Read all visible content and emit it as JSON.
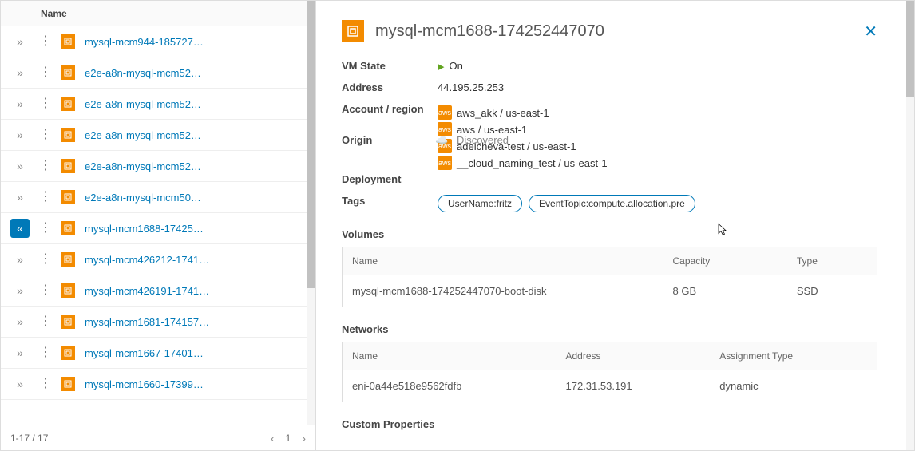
{
  "list": {
    "header": "Name",
    "rows": [
      {
        "name": "mysql-mcm944-185727…",
        "expanded": false
      },
      {
        "name": "e2e-a8n-mysql-mcm52…",
        "expanded": false
      },
      {
        "name": "e2e-a8n-mysql-mcm52…",
        "expanded": false
      },
      {
        "name": "e2e-a8n-mysql-mcm52…",
        "expanded": false
      },
      {
        "name": "e2e-a8n-mysql-mcm52…",
        "expanded": false
      },
      {
        "name": "e2e-a8n-mysql-mcm50…",
        "expanded": false
      },
      {
        "name": "mysql-mcm1688-17425…",
        "expanded": true
      },
      {
        "name": "mysql-mcm426212-1741…",
        "expanded": false
      },
      {
        "name": "mysql-mcm426191-1741…",
        "expanded": false
      },
      {
        "name": "mysql-mcm1681-174157…",
        "expanded": false
      },
      {
        "name": "mysql-mcm1667-17401…",
        "expanded": false
      },
      {
        "name": "mysql-mcm1660-17399…",
        "expanded": false
      }
    ],
    "footer_range": "1-17 / 17",
    "page_current": "1"
  },
  "detail": {
    "title": "mysql-mcm1688-174252447070",
    "labels": {
      "vm_state": "VM State",
      "address": "Address",
      "account_region": "Account / region",
      "origin": "Origin",
      "deployment": "Deployment",
      "tags": "Tags",
      "volumes": "Volumes",
      "networks": "Networks",
      "custom_properties": "Custom Properties"
    },
    "vm_state": "On",
    "address": "44.195.25.253",
    "accounts": [
      "aws_akk / us-east-1",
      "aws / us-east-1",
      "adelcheva-test / us-east-1",
      "__cloud_naming_test / us-east-1"
    ],
    "origin": "Discovered",
    "tags": [
      "UserName:fritz",
      "EventTopic:compute.allocation.pre"
    ],
    "volumes": {
      "headers": [
        "Name",
        "Capacity",
        "Type"
      ],
      "rows": [
        {
          "name": "mysql-mcm1688-174252447070-boot-disk",
          "capacity": "8 GB",
          "type": "SSD"
        }
      ]
    },
    "networks": {
      "headers": [
        "Name",
        "Address",
        "Assignment Type"
      ],
      "rows": [
        {
          "name": "eni-0a44e518e9562fdfb",
          "address": "172.31.53.191",
          "assignment_type": "dynamic"
        }
      ]
    }
  }
}
